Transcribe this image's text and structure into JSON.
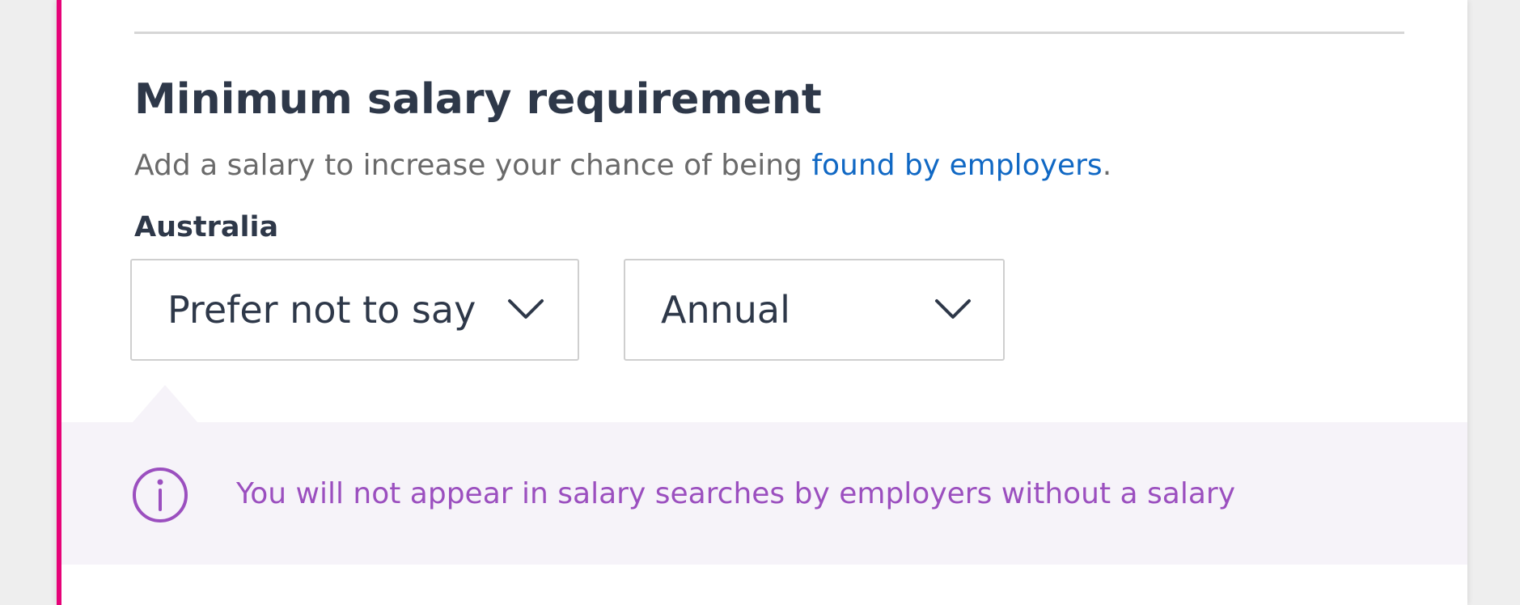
{
  "section": {
    "title": "Minimum salary requirement",
    "helper_prefix": "Add a salary to increase your chance of being ",
    "helper_link": "found by employers",
    "helper_suffix": ".",
    "country_label": "Australia"
  },
  "salary_amount_select": {
    "value": "Prefer not to say",
    "icon": "chevron-down-icon"
  },
  "salary_frequency_select": {
    "value": "Annual",
    "icon": "chevron-down-icon"
  },
  "notice": {
    "icon": "info-icon",
    "text": "You will not appear in salary searches by employers without a salary"
  },
  "colors": {
    "accent_border": "#e60278",
    "link": "#1068c4",
    "notice_text": "#9b4fbf",
    "notice_background": "#f6f3f9",
    "heading": "#2e3849"
  }
}
